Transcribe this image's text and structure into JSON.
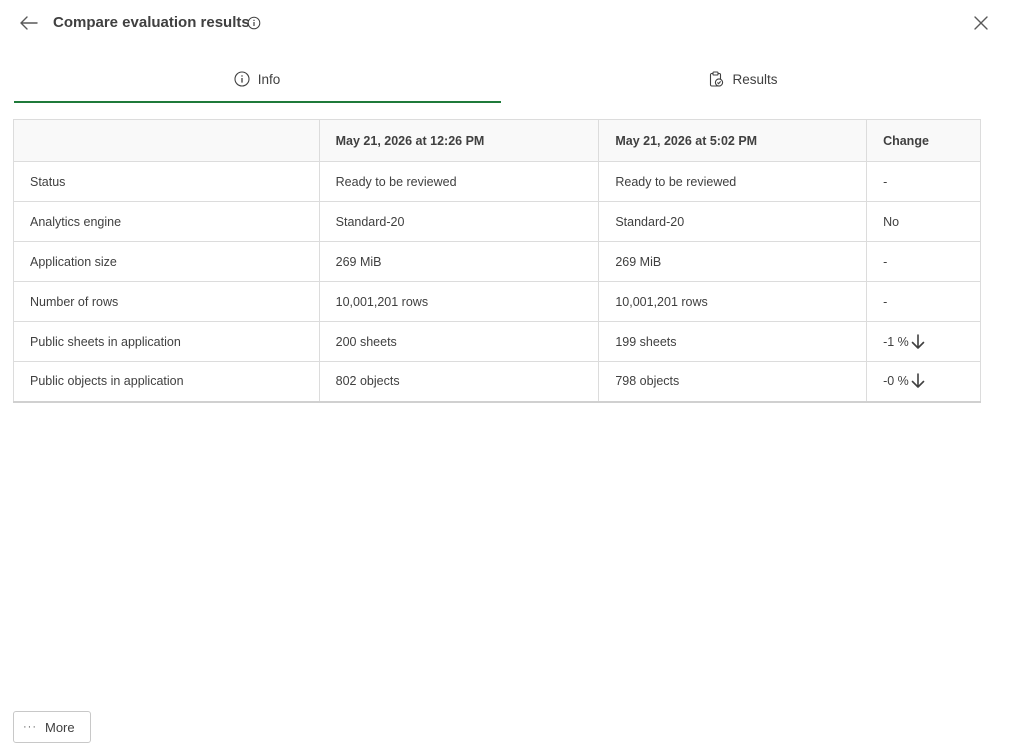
{
  "header": {
    "title": "Compare evaluation results",
    "back_icon": "arrow-left-icon",
    "info_icon": "info-icon",
    "close_icon": "close-icon"
  },
  "tabs": [
    {
      "label": "Info",
      "icon": "info-icon",
      "selected": true
    },
    {
      "label": "Results",
      "icon": "clipboard-check-icon",
      "selected": false
    }
  ],
  "accent_color": "#1f7a3a",
  "table": {
    "columns": [
      "",
      "May 21, 2026 at 12:26 PM",
      "May 21, 2026 at 5:02 PM",
      "Change"
    ],
    "rows": [
      {
        "metric": "Status",
        "first": "Ready to be reviewed",
        "second": "Ready to be reviewed",
        "change": "-",
        "trend": ""
      },
      {
        "metric": "Analytics engine",
        "first": "Standard-20",
        "second": "Standard-20",
        "change": "No",
        "trend": ""
      },
      {
        "metric": "Application size",
        "first": "269 MiB",
        "second": "269 MiB",
        "change": "-",
        "trend": ""
      },
      {
        "metric": "Number of rows",
        "first": "10,001,201 rows",
        "second": "10,001,201 rows",
        "change": "-",
        "trend": ""
      },
      {
        "metric": "Public sheets in application",
        "first": "200 sheets",
        "second": "199 sheets",
        "change": "-1 %",
        "trend": "down"
      },
      {
        "metric": "Public objects in application",
        "first": "802 objects",
        "second": "798 objects",
        "change": "-0 %",
        "trend": "down"
      }
    ]
  },
  "footer": {
    "more_label": "More",
    "more_icon": "more-dots-icon"
  }
}
